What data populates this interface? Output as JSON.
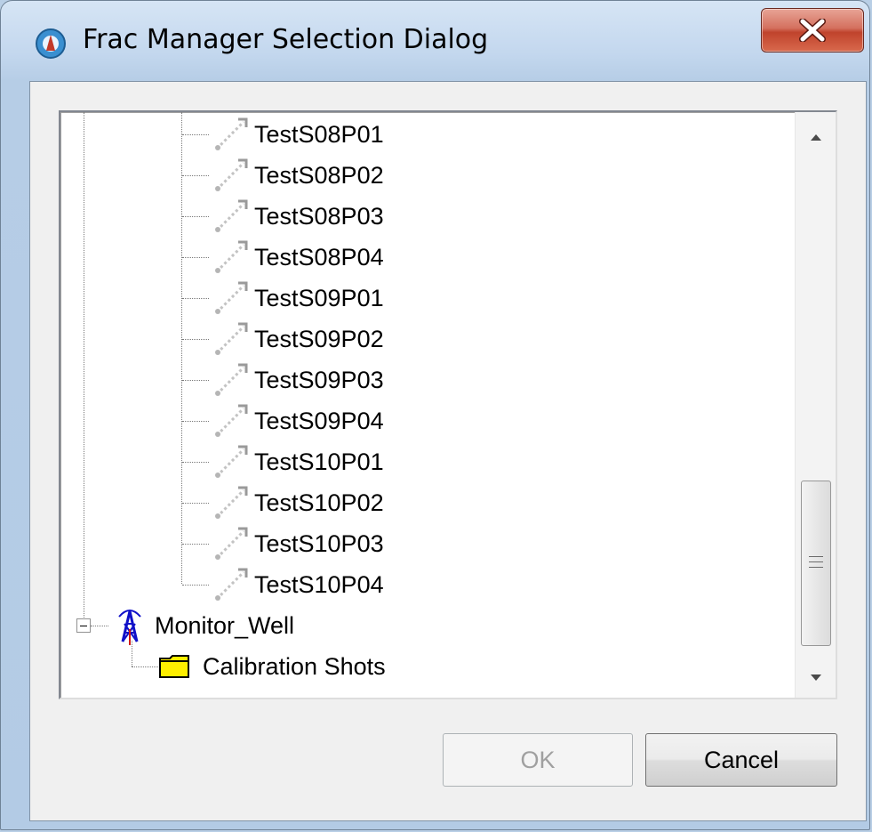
{
  "window": {
    "title": "Frac Manager Selection Dialog",
    "close_icon": "close-icon"
  },
  "tree": {
    "stages": [
      {
        "label": "TestS08P01",
        "icon": "frac-stage-icon"
      },
      {
        "label": "TestS08P02",
        "icon": "frac-stage-icon"
      },
      {
        "label": "TestS08P03",
        "icon": "frac-stage-icon"
      },
      {
        "label": "TestS08P04",
        "icon": "frac-stage-icon"
      },
      {
        "label": "TestS09P01",
        "icon": "frac-stage-icon"
      },
      {
        "label": "TestS09P02",
        "icon": "frac-stage-icon"
      },
      {
        "label": "TestS09P03",
        "icon": "frac-stage-icon"
      },
      {
        "label": "TestS09P04",
        "icon": "frac-stage-icon"
      },
      {
        "label": "TestS10P01",
        "icon": "frac-stage-icon"
      },
      {
        "label": "TestS10P02",
        "icon": "frac-stage-icon"
      },
      {
        "label": "TestS10P03",
        "icon": "frac-stage-icon"
      },
      {
        "label": "TestS10P04",
        "icon": "frac-stage-icon"
      }
    ],
    "monitor_well": {
      "label": "Monitor_Well",
      "icon": "well-tower-icon",
      "expanded": true
    },
    "calibration": {
      "label": "Calibration Shots",
      "icon": "folder-icon"
    }
  },
  "buttons": {
    "ok": {
      "label": "OK",
      "enabled": false
    },
    "cancel": {
      "label": "Cancel",
      "enabled": true
    }
  }
}
